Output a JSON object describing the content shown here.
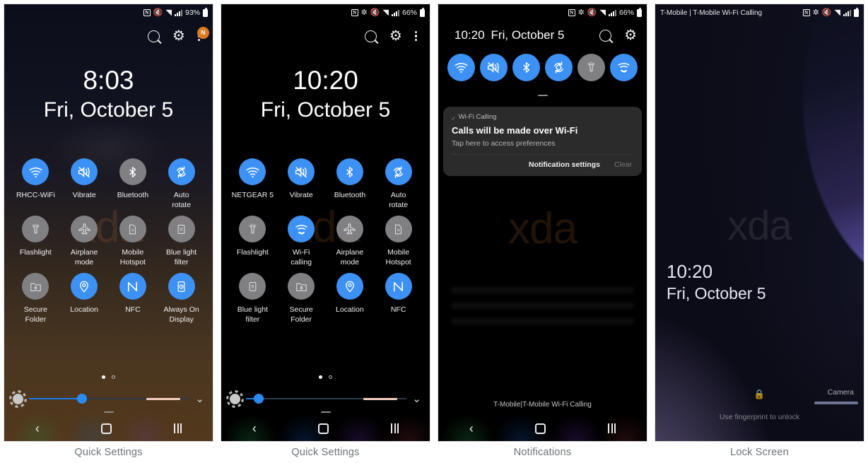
{
  "panels": [
    {
      "caption": "Quick Settings",
      "statusbar": {
        "left": "",
        "battery": "93%",
        "icons": [
          "nfc-icon",
          "mute-icon",
          "wifi-icon",
          "signal-icon",
          "battery-icon"
        ]
      },
      "header": {
        "search": "search-icon",
        "settings": "gear-icon",
        "menu": "more-options-icon",
        "badge": "N"
      },
      "clock": {
        "time": "8:03",
        "date": "Fri, October 5"
      },
      "watermark": "xda",
      "tiles": [
        {
          "label": "RHCC-WiFi",
          "icon": "wifi",
          "state": "on"
        },
        {
          "label": "Vibrate",
          "icon": "vibrate",
          "state": "on"
        },
        {
          "label": "Bluetooth",
          "icon": "bluetooth",
          "state": "off"
        },
        {
          "label": "Auto\nrotate",
          "icon": "autorotate",
          "state": "on"
        },
        {
          "label": "Flashlight",
          "icon": "flashlight",
          "state": "off"
        },
        {
          "label": "Airplane\nmode",
          "icon": "airplane",
          "state": "off"
        },
        {
          "label": "Mobile\nHotspot",
          "icon": "hotspot",
          "state": "off"
        },
        {
          "label": "Blue light\nfilter",
          "icon": "bluelight",
          "state": "off"
        },
        {
          "label": "Secure\nFolder",
          "icon": "securefolder",
          "state": "off"
        },
        {
          "label": "Location",
          "icon": "location",
          "state": "on"
        },
        {
          "label": "NFC",
          "icon": "nfc",
          "state": "on"
        },
        {
          "label": "Always On\nDisplay",
          "icon": "aod",
          "state": "on"
        }
      ],
      "pager": {
        "pages": 2,
        "current": 1
      },
      "brightness": {
        "value": 33
      },
      "navbar": [
        "back-button",
        "home-button",
        "recents-button"
      ]
    },
    {
      "caption": "Quick Settings",
      "statusbar": {
        "left": "",
        "battery": "66%",
        "icons": [
          "nfc-icon",
          "bluetooth-icon",
          "mute-icon",
          "wifi-icon",
          "signal-icon",
          "battery-icon"
        ]
      },
      "header": {
        "search": "search-icon",
        "settings": "gear-icon",
        "menu": "more-options-icon",
        "badge": ""
      },
      "clock": {
        "time": "10:20",
        "date": "Fri, October 5"
      },
      "watermark": "xda",
      "tiles": [
        {
          "label": "NETGEAR 5",
          "icon": "wifi",
          "state": "on"
        },
        {
          "label": "Vibrate",
          "icon": "vibrate",
          "state": "on"
        },
        {
          "label": "Bluetooth",
          "icon": "bluetooth",
          "state": "on"
        },
        {
          "label": "Auto\nrotate",
          "icon": "autorotate",
          "state": "on"
        },
        {
          "label": "Flashlight",
          "icon": "flashlight",
          "state": "off"
        },
        {
          "label": "Wi-Fi\ncalling",
          "icon": "wificalling",
          "state": "on"
        },
        {
          "label": "Airplane\nmode",
          "icon": "airplane",
          "state": "off"
        },
        {
          "label": "Mobile\nHotspot",
          "icon": "hotspot",
          "state": "off"
        },
        {
          "label": "Blue light\nfilter",
          "icon": "bluelight",
          "state": "off"
        },
        {
          "label": "Secure\nFolder",
          "icon": "securefolder",
          "state": "off"
        },
        {
          "label": "Location",
          "icon": "location",
          "state": "on"
        },
        {
          "label": "NFC",
          "icon": "nfc",
          "state": "on"
        }
      ],
      "pager": {
        "pages": 2,
        "current": 1
      },
      "brightness": {
        "value": 8
      },
      "navbar": [
        "back-button",
        "home-button",
        "recents-button"
      ]
    },
    {
      "caption": "Notifications",
      "statusbar": {
        "left": "",
        "battery": "66%",
        "icons": [
          "nfc-icon",
          "bluetooth-icon",
          "mute-icon",
          "wifi-icon",
          "signal-icon",
          "battery-icon"
        ]
      },
      "clock": {
        "time": "10:20",
        "date": "Fri, October 5"
      },
      "header": {
        "search": "search-icon",
        "settings": "gear-icon"
      },
      "tiles": [
        {
          "label": "Wi-Fi",
          "icon": "wifi",
          "state": "on"
        },
        {
          "label": "Vibrate",
          "icon": "vibrate",
          "state": "on"
        },
        {
          "label": "Bluetooth",
          "icon": "bluetooth",
          "state": "on"
        },
        {
          "label": "Auto rotate",
          "icon": "autorotate",
          "state": "on"
        },
        {
          "label": "Flashlight",
          "icon": "flashlight",
          "state": "off"
        },
        {
          "label": "Wi-Fi calling",
          "icon": "wificalling",
          "state": "on"
        }
      ],
      "notification": {
        "app": "Wi-Fi Calling",
        "title": "Calls will be made over Wi-Fi",
        "body": "Tap here to access preferences",
        "action_settings": "Notification settings",
        "action_clear": "Clear"
      },
      "carrier": "T-Mobile|T-Mobile Wi-Fi Calling",
      "navbar": [
        "back-button",
        "home-button",
        "recents-button"
      ]
    },
    {
      "caption": "Lock Screen",
      "statusbar": {
        "left": "T-Mobile | T-Mobile Wi-Fi Calling",
        "battery": "",
        "icons": [
          "nfc-icon",
          "bluetooth-icon",
          "mute-icon",
          "wifi-icon",
          "signal-icon",
          "battery-icon"
        ]
      },
      "clock": {
        "time": "10:20",
        "date": "Fri, October 5"
      },
      "watermark": "xda",
      "lock_icon": "lock-icon",
      "camera_label": "Camera",
      "hint": "Use fingerprint to unlock"
    }
  ],
  "colors": {
    "accent_on": "#3d91f5",
    "tile_off": "#808083",
    "badge": "#e8801f",
    "slider": "#1a7ae8"
  }
}
